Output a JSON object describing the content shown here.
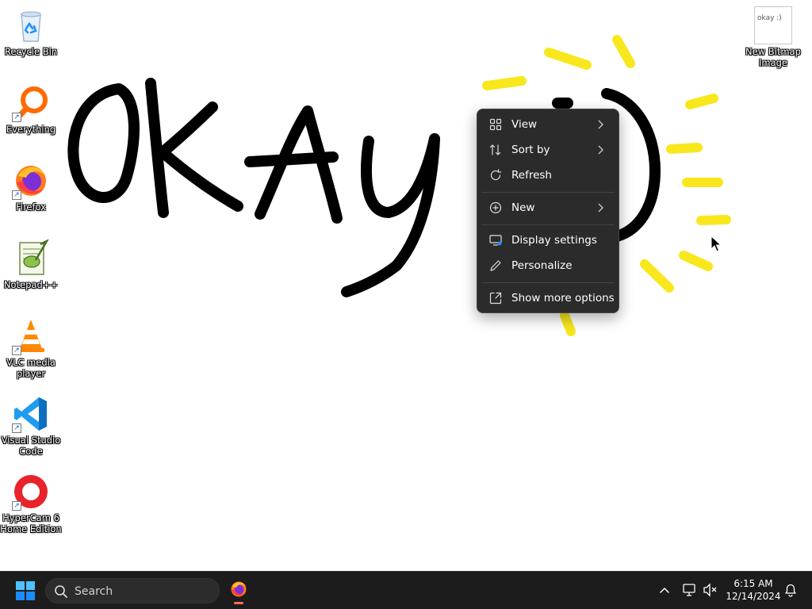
{
  "desktop": {
    "icons": [
      {
        "label": "Recycle Bin"
      },
      {
        "label": "Everything"
      },
      {
        "label": "Firefox"
      },
      {
        "label": "Notepad++"
      },
      {
        "label": "VLC media player"
      },
      {
        "label": "Visual Studio Code"
      },
      {
        "label": "HyperCam 6 Home Edition"
      },
      {
        "label": "New Bitmap Image",
        "thumbnail_text": "okay :)"
      }
    ]
  },
  "context_menu": {
    "items": [
      {
        "label": "View",
        "icon": "grid-icon",
        "submenu": true
      },
      {
        "label": "Sort by",
        "icon": "sort-icon",
        "submenu": true
      },
      {
        "label": "Refresh",
        "icon": "refresh-icon",
        "submenu": false
      },
      {
        "label": "New",
        "icon": "plus-circle-icon",
        "submenu": true
      },
      {
        "label": "Display settings",
        "icon": "display-icon",
        "submenu": false
      },
      {
        "label": "Personalize",
        "icon": "pen-icon",
        "submenu": false
      },
      {
        "label": "Show more options",
        "icon": "expand-icon",
        "submenu": false
      }
    ]
  },
  "taskbar": {
    "search_placeholder": "Search",
    "clock_time": "6:15 AM",
    "clock_date": "12/14/2024"
  },
  "colors": {
    "taskbar_bg": "#1c1c1c",
    "menu_bg": "#2b2b2b",
    "menu_text": "#ffffff",
    "ink": "#000000",
    "highlighter": "#f8e71c",
    "accent_blue": "#1a8cff"
  }
}
